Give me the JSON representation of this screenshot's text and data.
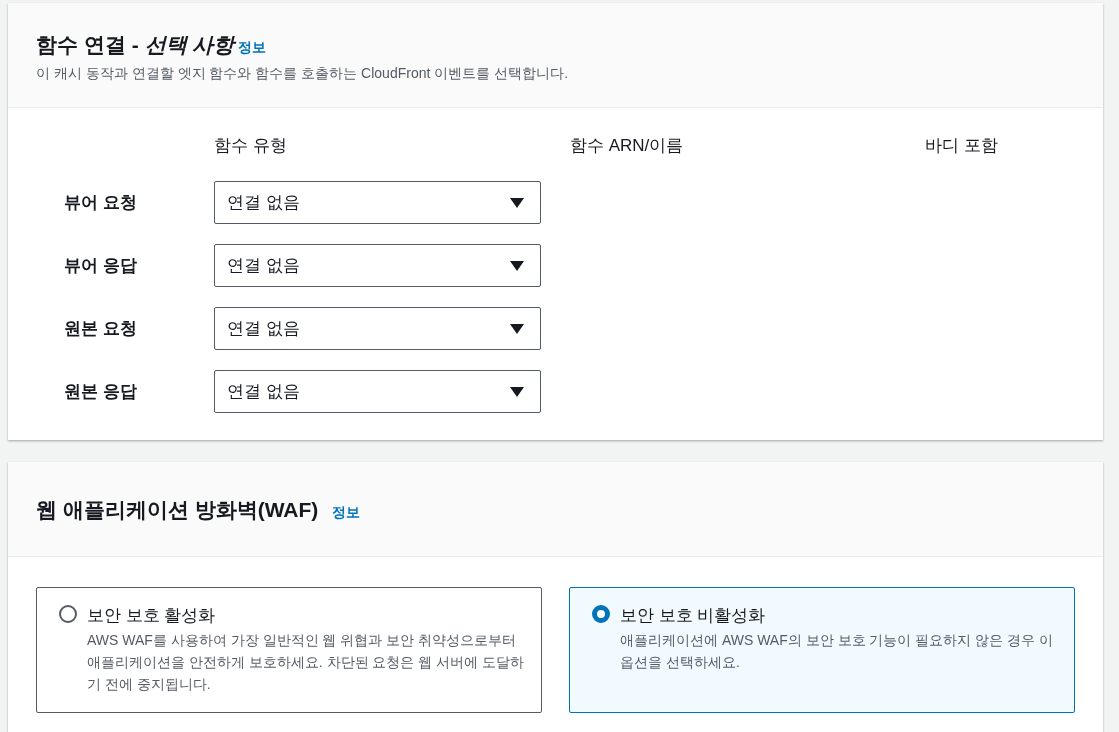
{
  "function_associations": {
    "title": "함수 연결 - *선택 사항*",
    "info_link": "정보",
    "description": "이 캐시 동작과 연결할 엣지 함수와 함수를 호출하는 CloudFront 이벤트를 선택합니다.",
    "columns": [
      "함수 유형",
      "함수 ARN/이름",
      "바디 포함"
    ],
    "rows": [
      {
        "label": "뷰어 요청",
        "function_type": "연결 없음"
      },
      {
        "label": "뷰어 응답",
        "function_type": "연결 없음"
      },
      {
        "label": "원본 요청",
        "function_type": "연결 없음"
      },
      {
        "label": "원본 응답",
        "function_type": "연결 없음"
      }
    ]
  },
  "waf": {
    "title": "웹 애플리케이션 방화벽(WAF)",
    "info_link": "정보",
    "options": [
      {
        "label": "보안 보호 활성화",
        "description": "AWS WAF를 사용하여 가장 일반적인 웹 위협과 보안 취약성으로부터 애플리케이션을 안전하게 보호하세요. 차단된 요청은 웹 서버에 도달하기 전에 중지됩니다.",
        "selected": false
      },
      {
        "label": "보안 보호 비활성화",
        "description": "애플리케이션에 AWS WAF의 보안 보호 기능이 필요하지 않은 경우 이 옵션을 선택하세요.",
        "selected": true
      }
    ]
  }
}
